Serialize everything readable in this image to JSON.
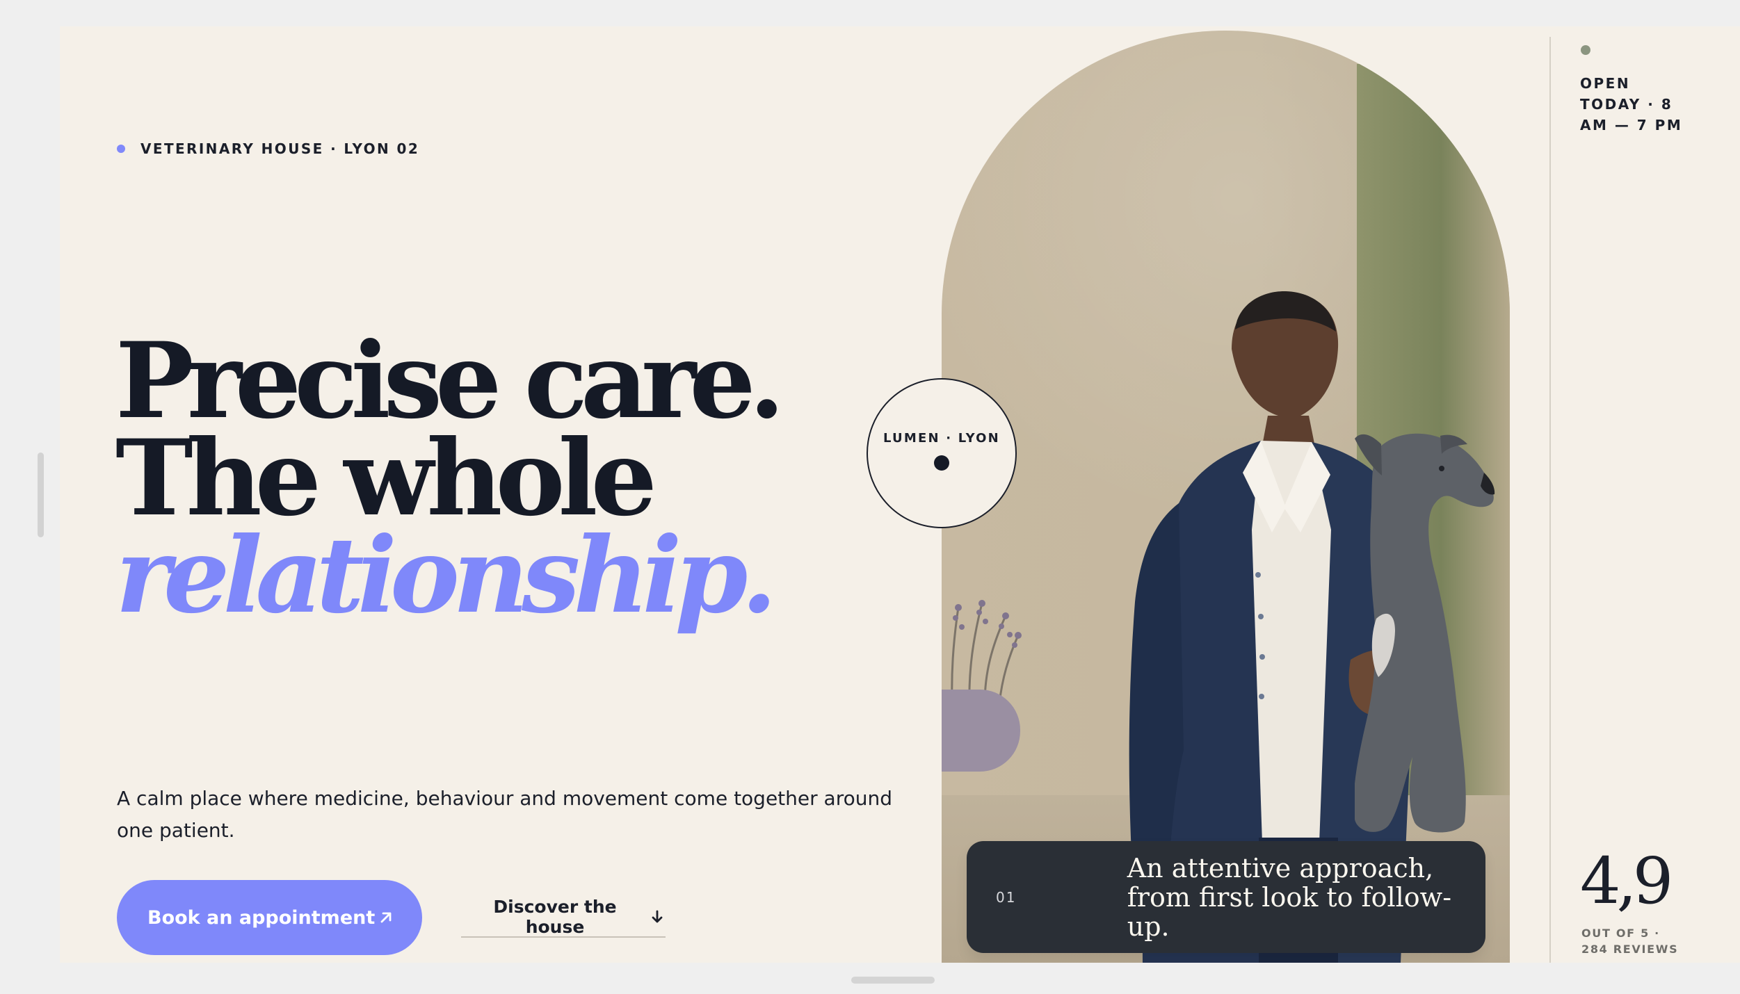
{
  "eyebrow": {
    "label": "VETERINARY HOUSE · LYON 02"
  },
  "hero": {
    "headline_line_1": "Precise care.",
    "headline_line_2": "The whole",
    "headline_accent": "relationship.",
    "lead": "A calm place where medicine, behaviour and movement come together around one patient.",
    "primary_cta": "Book an appointment",
    "secondary_cta": "Discover the house"
  },
  "badge": {
    "text": "LUMEN · LYON"
  },
  "quote_card": {
    "number": "01",
    "text": "An attentive approach, from first look to follow-up."
  },
  "sidebar": {
    "status": "OPEN TODAY · 8 AM — 7 PM",
    "rating_value": "4,9",
    "rating_caption": "OUT OF 5 · 284 REVIEWS"
  },
  "colors": {
    "background": "#f5f0e8",
    "accent": "#7f88fa",
    "ink": "#151a26",
    "card": "#2a2f36"
  },
  "icons": {
    "primary_cta": "arrow-up-right-icon",
    "secondary_cta": "arrow-down-icon"
  }
}
